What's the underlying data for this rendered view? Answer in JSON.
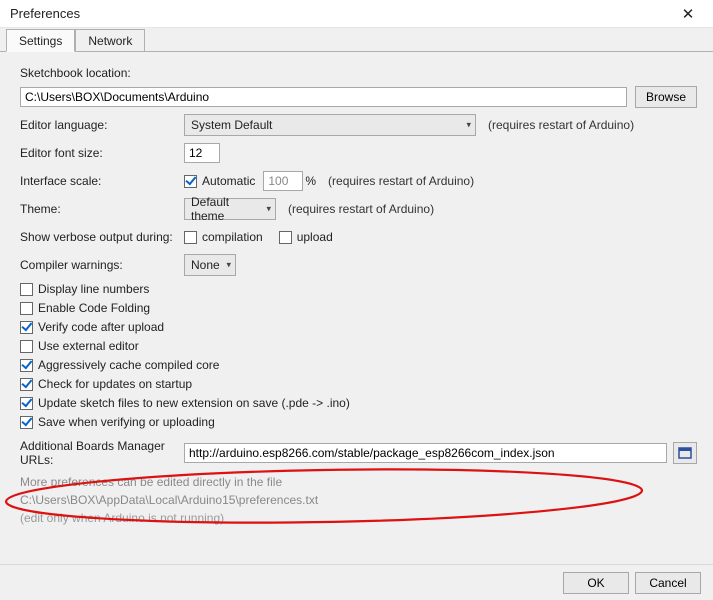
{
  "window": {
    "title": "Preferences"
  },
  "tabs": {
    "settings": "Settings",
    "network": "Network"
  },
  "sketchbook": {
    "label": "Sketchbook location:",
    "value": "C:\\Users\\BOX\\Documents\\Arduino",
    "browse": "Browse"
  },
  "language": {
    "label": "Editor language:",
    "value": "System Default",
    "hint": "(requires restart of Arduino)"
  },
  "fontsize": {
    "label": "Editor font size:",
    "value": "12"
  },
  "scale": {
    "label": "Interface scale:",
    "auto_label": "Automatic",
    "auto_checked": true,
    "value": "100",
    "pct": "%",
    "hint": "(requires restart of Arduino)"
  },
  "theme": {
    "label": "Theme:",
    "value": "Default theme",
    "hint": "(requires restart of Arduino)"
  },
  "verbose": {
    "label": "Show verbose output during:",
    "compilation_label": "compilation",
    "compilation_checked": false,
    "upload_label": "upload",
    "upload_checked": false
  },
  "warnings": {
    "label": "Compiler warnings:",
    "value": "None"
  },
  "checks": {
    "display_line_numbers": {
      "label": "Display line numbers",
      "checked": false
    },
    "enable_code_folding": {
      "label": "Enable Code Folding",
      "checked": false
    },
    "verify_after_upload": {
      "label": "Verify code after upload",
      "checked": true
    },
    "external_editor": {
      "label": "Use external editor",
      "checked": false
    },
    "cache_core": {
      "label": "Aggressively cache compiled core",
      "checked": true
    },
    "check_updates": {
      "label": "Check for updates on startup",
      "checked": true
    },
    "update_ext": {
      "label": "Update sketch files to new extension on save (.pde -> .ino)",
      "checked": true
    },
    "save_on_verify": {
      "label": "Save when verifying or uploading",
      "checked": true
    }
  },
  "boards_url": {
    "label": "Additional Boards Manager URLs:",
    "value": "http://arduino.esp8266.com/stable/package_esp8266com_index.json"
  },
  "notes": {
    "more_prefs": "More preferences can be edited directly in the file",
    "path": "C:\\Users\\BOX\\AppData\\Local\\Arduino15\\preferences.txt",
    "edit_only": "(edit only when Arduino is not running)"
  },
  "footer": {
    "ok": "OK",
    "cancel": "Cancel"
  }
}
